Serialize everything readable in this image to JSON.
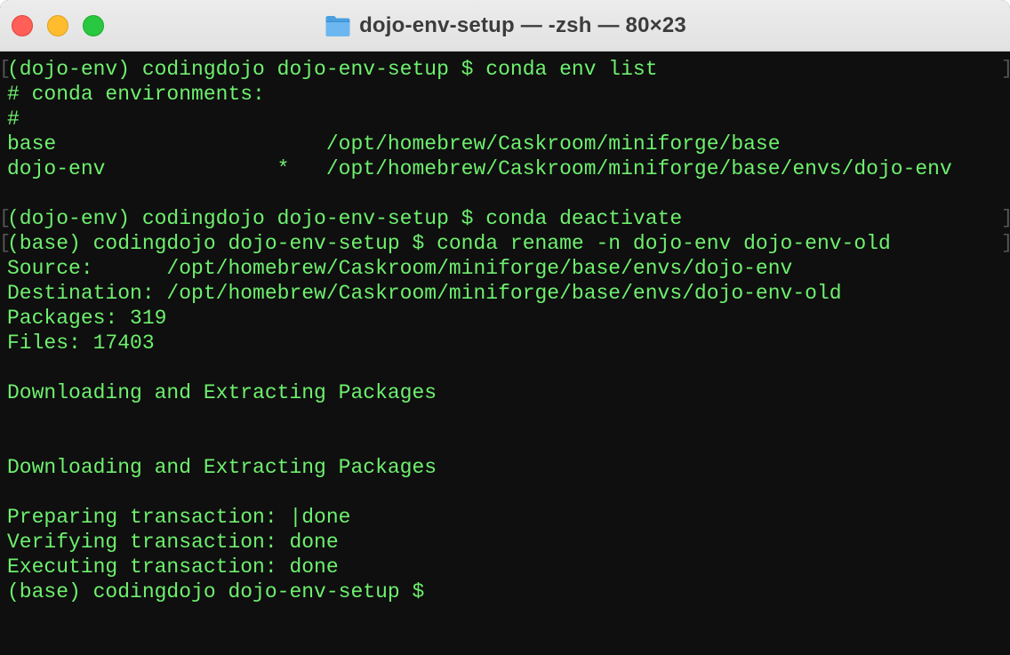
{
  "window": {
    "title": "dojo-env-setup — -zsh — 80×23",
    "colors": {
      "text": "#6ef06e",
      "background": "#0f0f0f",
      "close": "#fe5f57",
      "minimize": "#febc2e",
      "zoom": "#28c840"
    }
  },
  "terminal": {
    "lines": [
      "(dojo-env) codingdojo dojo-env-setup $ conda env list",
      "# conda environments:",
      "#",
      "base                      /opt/homebrew/Caskroom/miniforge/base",
      "dojo-env              *   /opt/homebrew/Caskroom/miniforge/base/envs/dojo-env",
      "",
      "(dojo-env) codingdojo dojo-env-setup $ conda deactivate",
      "(base) codingdojo dojo-env-setup $ conda rename -n dojo-env dojo-env-old",
      "Source:      /opt/homebrew/Caskroom/miniforge/base/envs/dojo-env",
      "Destination: /opt/homebrew/Caskroom/miniforge/base/envs/dojo-env-old",
      "Packages: 319",
      "Files: 17403",
      "",
      "Downloading and Extracting Packages",
      "",
      "",
      "Downloading and Extracting Packages",
      "",
      "Preparing transaction: |done",
      "Verifying transaction: done",
      "Executing transaction: done",
      "(base) codingdojo dojo-env-setup $"
    ],
    "left_mark": "[",
    "right_mark": "]"
  }
}
